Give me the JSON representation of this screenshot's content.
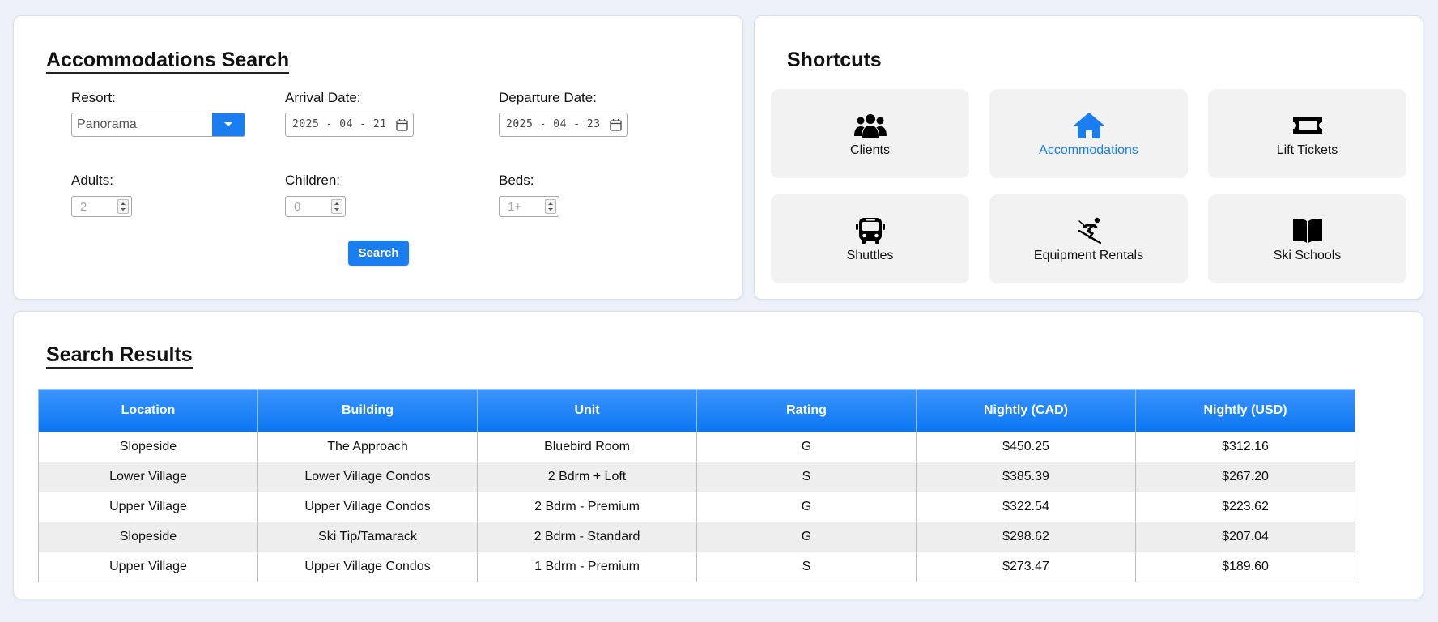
{
  "search": {
    "title": "Accommodations Search",
    "resort_label": "Resort:",
    "resort_value": "Panorama",
    "arrival_label": "Arrival Date:",
    "arrival_value": "2025 - 04 - 21",
    "departure_label": "Departure Date:",
    "departure_value": "2025 - 04 - 23",
    "adults_label": "Adults:",
    "adults_value": "2",
    "children_label": "Children:",
    "children_value": "0",
    "beds_label": "Beds:",
    "beds_value": "1+",
    "search_button": "Search",
    "accent_color": "#1a7ef0"
  },
  "shortcuts": {
    "title": "Shortcuts",
    "items": [
      {
        "label": "Clients",
        "icon": "users-icon",
        "active": false
      },
      {
        "label": "Accommodations",
        "icon": "home-icon",
        "active": true
      },
      {
        "label": "Lift Tickets",
        "icon": "ticket-icon",
        "active": false
      },
      {
        "label": "Shuttles",
        "icon": "bus-icon",
        "active": false
      },
      {
        "label": "Equipment Rentals",
        "icon": "skier-icon",
        "active": false
      },
      {
        "label": "Ski Schools",
        "icon": "book-icon",
        "active": false
      }
    ]
  },
  "results": {
    "title": "Search Results",
    "columns": [
      "Location",
      "Building",
      "Unit",
      "Rating",
      "Nightly (CAD)",
      "Nightly (USD)"
    ],
    "rows": [
      [
        "Slopeside",
        "The Approach",
        "Bluebird Room",
        "G",
        "$450.25",
        "$312.16"
      ],
      [
        "Lower Village",
        "Lower Village Condos",
        "2 Bdrm + Loft",
        "S",
        "$385.39",
        "$267.20"
      ],
      [
        "Upper Village",
        "Upper Village Condos",
        "2 Bdrm - Premium",
        "G",
        "$322.54",
        "$223.62"
      ],
      [
        "Slopeside",
        "Ski Tip/Tamarack",
        "2 Bdrm - Standard",
        "G",
        "$298.62",
        "$207.04"
      ],
      [
        "Upper Village",
        "Upper Village Condos",
        "1 Bdrm - Premium",
        "S",
        "$273.47",
        "$189.60"
      ]
    ],
    "header_color": "#1a7ef0"
  }
}
